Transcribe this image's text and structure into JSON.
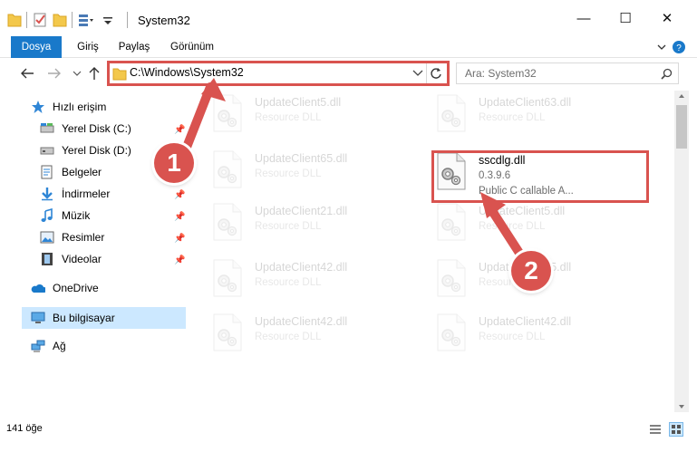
{
  "window": {
    "title": "System32",
    "minimize_glyph": "—",
    "maximize_glyph": "☐",
    "close_glyph": "✕"
  },
  "ribbon": {
    "tabs": [
      "Dosya",
      "Giriş",
      "Paylaş",
      "Görünüm"
    ]
  },
  "address": {
    "path": "C:\\Windows\\System32"
  },
  "search": {
    "placeholder": "Ara: System32"
  },
  "sidebar": {
    "items": [
      {
        "label": "Hızlı erişim",
        "icon": "star-icon",
        "pinned": false
      },
      {
        "label": "Yerel Disk (C:)",
        "icon": "drive-icon",
        "pinned": true
      },
      {
        "label": "Yerel Disk (D:)",
        "icon": "drive-icon",
        "pinned": true
      },
      {
        "label": "Belgeler",
        "icon": "documents-icon",
        "pinned": true
      },
      {
        "label": "İndirmeler",
        "icon": "downloads-icon",
        "pinned": true
      },
      {
        "label": "Müzik",
        "icon": "music-icon",
        "pinned": true
      },
      {
        "label": "Resimler",
        "icon": "pictures-icon",
        "pinned": true
      },
      {
        "label": "Videolar",
        "icon": "videos-icon",
        "pinned": true
      },
      {
        "label": "OneDrive",
        "icon": "onedrive-icon",
        "pinned": false
      },
      {
        "label": "Bu bilgisayar",
        "icon": "computer-icon",
        "pinned": false
      },
      {
        "label": "Ağ",
        "icon": "network-icon",
        "pinned": false
      }
    ]
  },
  "files": [
    {
      "name": "UpdateClient5.dll",
      "desc": "Resource DLL",
      "faded": true
    },
    {
      "name": "UpdateClient63.dll",
      "desc": "Resource DLL",
      "faded": true
    },
    {
      "name": "UpdateClient65.dll",
      "desc": "Resource DLL",
      "faded": true
    },
    {
      "name": "sscdlg.dll",
      "version": "0.3.9.6",
      "desc": "Public C callable A...",
      "faded": false
    },
    {
      "name": "UpdateClient21.dll",
      "desc": "Resource DLL",
      "faded": true
    },
    {
      "name": "UpdateClient5.dll",
      "desc": "Resource DLL",
      "faded": true
    },
    {
      "name": "UpdateClient42.dll",
      "desc": "Resource DLL",
      "faded": true
    },
    {
      "name": "UpdateClient65.dll",
      "desc": "Resource DLL",
      "faded": true
    },
    {
      "name": "UpdateClient42.dll",
      "desc": "Resource DLL",
      "faded": true
    },
    {
      "name": "UpdateClient42.dll",
      "desc": "Resource DLL",
      "faded": true
    }
  ],
  "status": {
    "count": "141 öğe"
  },
  "annotations": {
    "step1": "1",
    "step2": "2",
    "color": "#d9534f"
  },
  "colors": {
    "accent": "#1979ca",
    "selection": "#cce8ff"
  }
}
